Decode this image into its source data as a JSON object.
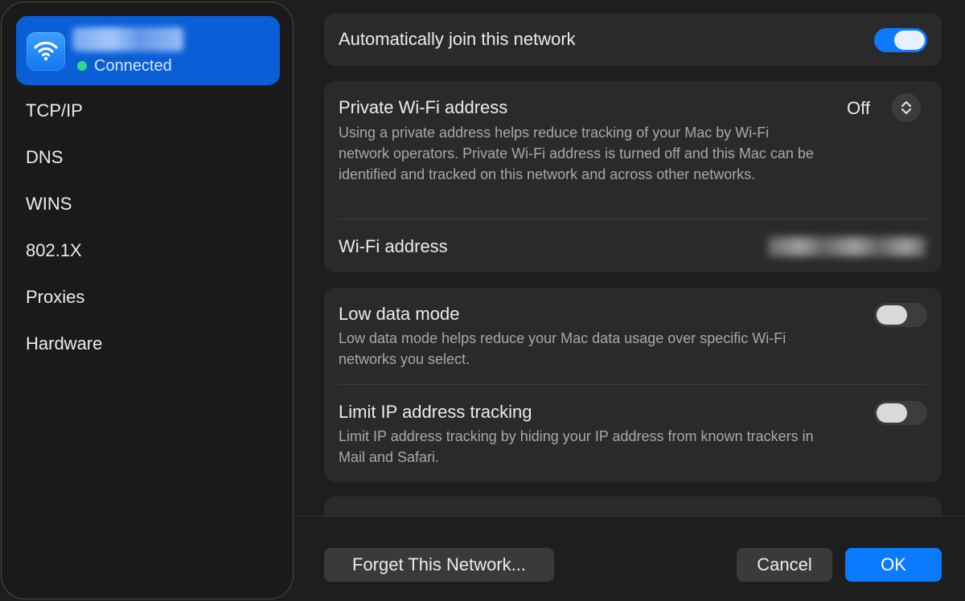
{
  "sidebar": {
    "network": {
      "status": "Connected",
      "icon": "wifi-icon"
    },
    "items": [
      {
        "label": "TCP/IP"
      },
      {
        "label": "DNS"
      },
      {
        "label": "WINS"
      },
      {
        "label": "802.1X"
      },
      {
        "label": "Proxies"
      },
      {
        "label": "Hardware"
      }
    ]
  },
  "main": {
    "auto_join": {
      "label": "Automatically join this network",
      "enabled": true
    },
    "private_address": {
      "label": "Private Wi-Fi address",
      "value": "Off",
      "description": "Using a private address helps reduce tracking of your Mac by Wi-Fi network operators. Private Wi-Fi address is turned off and this Mac can be identified and tracked on this network and across other networks."
    },
    "wifi_address": {
      "label": "Wi-Fi address"
    },
    "low_data_mode": {
      "label": "Low data mode",
      "enabled": false,
      "description": "Low data mode helps reduce your Mac data usage over specific Wi-Fi networks you select."
    },
    "limit_ip": {
      "label": "Limit IP address tracking",
      "enabled": false,
      "description": "Limit IP address tracking by hiding your IP address from known trackers in Mail and Safari."
    }
  },
  "footer": {
    "forget_label": "Forget This Network...",
    "cancel_label": "Cancel",
    "ok_label": "OK"
  },
  "colors": {
    "accent": "#0a7aff",
    "selected_row": "#0a5ed6",
    "connected_dot": "#30d88a"
  }
}
